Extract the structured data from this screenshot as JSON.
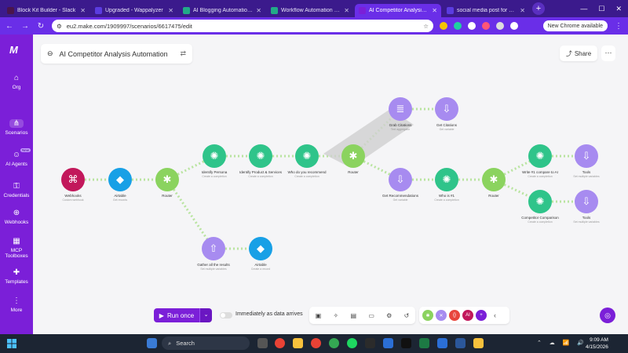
{
  "browser": {
    "tabs": [
      {
        "title": "Block Kit Builder - Slack",
        "color": "#4a154b",
        "active": false
      },
      {
        "title": "Upgraded - Wappalyzer",
        "color": "#5b3ce0",
        "active": false
      },
      {
        "title": "AI Blogging Automation W",
        "color": "#22aa88",
        "active": false
      },
      {
        "title": "Workflow Automation for t",
        "color": "#22aa88",
        "active": false
      },
      {
        "title": "AI Competitor Analysis Au",
        "color": "#7b1fd8",
        "active": true
      },
      {
        "title": "social media post for disc",
        "color": "#5b3ce0",
        "active": false
      }
    ],
    "url": "eu2.make.com/1909997/scenarios/6617475/edit",
    "profile_button": "New Chrome available"
  },
  "sidebar": {
    "items": [
      {
        "label": "Org",
        "icon": "home-icon"
      },
      {
        "label": "Scenarios",
        "icon": "share-nodes-icon"
      },
      {
        "label": "AI Agents",
        "icon": "robot-icon",
        "badge": "New"
      },
      {
        "label": "Credentials",
        "icon": "key-icon"
      },
      {
        "label": "Webhooks",
        "icon": "globe-icon"
      },
      {
        "label": "MCP Toolboxes",
        "icon": "toolbox-icon"
      },
      {
        "label": "Templates",
        "icon": "puzzle-icon"
      },
      {
        "label": "More",
        "icon": "more-dots-icon"
      }
    ]
  },
  "scenario": {
    "title": "AI Competitor Analysis Automation",
    "share_label": "Share",
    "more_label": "⋯"
  },
  "nodes": [
    {
      "label": "Webhooks",
      "sub": "Custom webhook",
      "color": "#c2185b",
      "icon": "webhook-icon"
    },
    {
      "label": "Airtable",
      "sub": "Get records",
      "color": "#18a0e6",
      "icon": "airtable-icon"
    },
    {
      "label": "Router",
      "sub": "",
      "color": "#8bd35f",
      "icon": "router-icon"
    },
    {
      "label": "Identify Persona",
      "sub": "Create a completion",
      "color": "#2fc48a",
      "icon": "openai-icon"
    },
    {
      "label": "Identify Product & Services",
      "sub": "Create a completion",
      "color": "#2fc48a",
      "icon": "openai-icon"
    },
    {
      "label": "Who do you recommend",
      "sub": "Create a completion",
      "color": "#2fc48a",
      "icon": "openai-icon"
    },
    {
      "label": "Router",
      "sub": "",
      "color": "#8bd35f",
      "icon": "router-icon"
    },
    {
      "label": "Grab Citations",
      "sub": "Text aggregator",
      "color": "#a78bf0",
      "icon": "aggregator-icon"
    },
    {
      "label": "Get Citations",
      "sub": "Get variable",
      "color": "#a78bf0",
      "icon": "download-icon"
    },
    {
      "label": "Get Recommendations",
      "sub": "Get variable",
      "color": "#a78bf0",
      "icon": "download-icon"
    },
    {
      "label": "Who is #1",
      "sub": "Create a completion",
      "color": "#2fc48a",
      "icon": "openai-icon"
    },
    {
      "label": "Router",
      "sub": "",
      "color": "#8bd35f",
      "icon": "router-icon"
    },
    {
      "label": "Write #1 compare to AI",
      "sub": "Create a completion",
      "color": "#2fc48a",
      "icon": "openai-icon"
    },
    {
      "label": "Tools",
      "sub": "Set multiple variables",
      "color": "#a78bf0",
      "icon": "download-icon"
    },
    {
      "label": "Competitor Comparison",
      "sub": "Create a completion",
      "color": "#2fc48a",
      "icon": "openai-icon"
    },
    {
      "label": "Tools",
      "sub": "Set multiple variables",
      "color": "#a78bf0",
      "icon": "download-icon"
    },
    {
      "label": "Gather all the results",
      "sub": "Set multiple variables",
      "color": "#a78bf0",
      "icon": "upload-icon"
    },
    {
      "label": "Airtable",
      "sub": "Create a record",
      "color": "#18a0e6",
      "icon": "airtable-icon"
    }
  ],
  "toolbar": {
    "run_label": "Run once",
    "immediately_label": "Immediately as data arrives",
    "immediately_on": false,
    "tools": [
      "save-icon",
      "magic-wand-icon",
      "notes-icon",
      "flow-control-icon",
      "settings-icon",
      "history-icon"
    ],
    "apps": [
      {
        "label": "",
        "color": "#8bd35f"
      },
      {
        "label": "",
        "color": "#a78bf0"
      },
      {
        "label": "{ }",
        "color": "#e8453c"
      },
      {
        "label": "AI",
        "color": "#c2185b"
      }
    ]
  },
  "taskbar": {
    "search_label": "Search",
    "time": "9:09 AM",
    "date": "4/15/2026"
  }
}
